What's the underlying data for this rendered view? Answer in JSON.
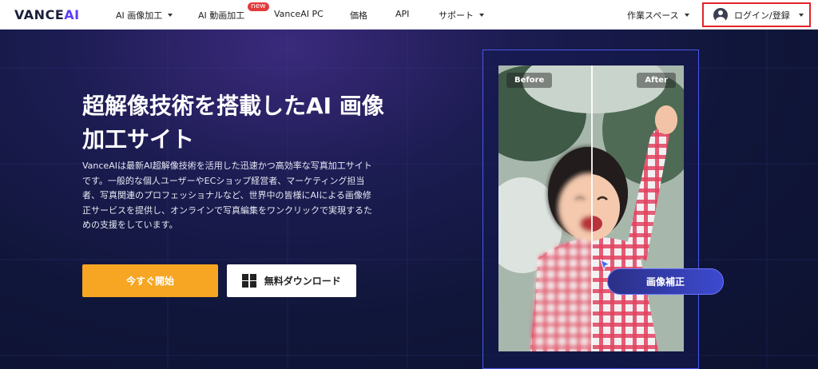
{
  "header": {
    "logo": {
      "main": "VANCE",
      "accent": "AI"
    },
    "nav": [
      {
        "label": "AI 画像加工",
        "dropdown": true
      },
      {
        "label": "AI 動画加工",
        "dropdown": false,
        "badge": "new"
      },
      {
        "label": "VanceAI PC",
        "dropdown": false
      },
      {
        "label": "価格",
        "dropdown": false
      },
      {
        "label": "API",
        "dropdown": false
      },
      {
        "label": "サポート",
        "dropdown": true
      }
    ],
    "workspace": "作業スペース",
    "login": "ログイン/登録"
  },
  "hero": {
    "headline_line1": "超解像技術を搭載したAI 画像",
    "headline_line2": "加工サイト",
    "description": "VanceAIは最新AI超解像技術を活用した迅速かつ高効率な写真加工サイトです。一般的な個人ユーザーやECショップ経営者、マーケティング担当者、写真関連のプロフェッショナルなど、世界中の皆様にAIによる画像修正サービスを提供し、オンラインで写真編集をワンクリックで実現するための支援をしています。",
    "primary_button": "今すぐ開始",
    "download_button": "無料ダウンロード"
  },
  "demo": {
    "before_label": "Before",
    "after_label": "After",
    "enhance_button": "画像補正"
  },
  "colors": {
    "accent": "#5b3ff6",
    "primary_button": "#f6a623",
    "login_highlight": "#e3242b",
    "demo_border": "#4b57e8"
  }
}
